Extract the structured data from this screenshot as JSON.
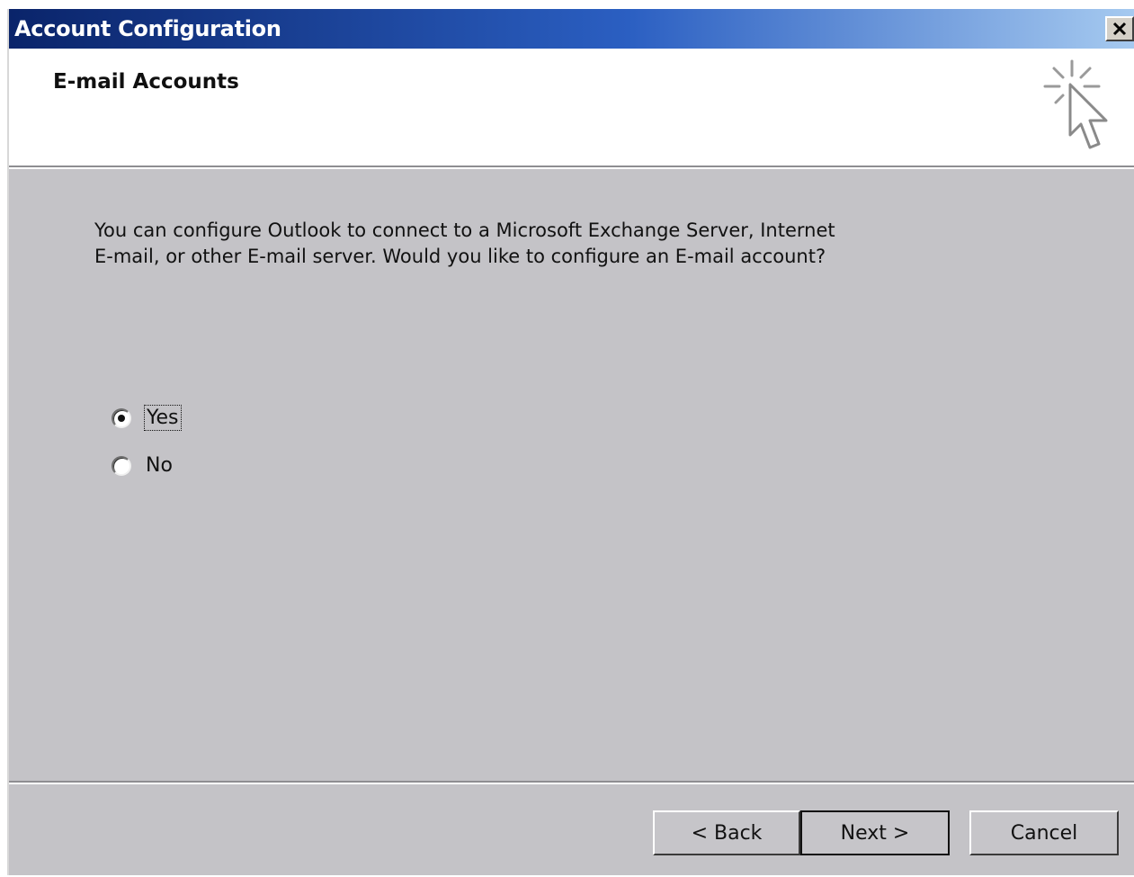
{
  "window": {
    "title": "Account Configuration",
    "close_icon": "close-icon"
  },
  "header": {
    "title": "E-mail Accounts",
    "icon": "sparkle-cursor-icon"
  },
  "main": {
    "question_line1": "You can configure Outlook to connect to a Microsoft Exchange Server, Internet",
    "question_line2": "E-mail, or other E-mail server.  Would you like to configure an E-mail account?",
    "options": [
      {
        "label": "Yes",
        "selected": true
      },
      {
        "label": "No",
        "selected": false
      }
    ]
  },
  "footer": {
    "back_label": "< Back",
    "next_label": "Next >",
    "cancel_label": "Cancel"
  }
}
